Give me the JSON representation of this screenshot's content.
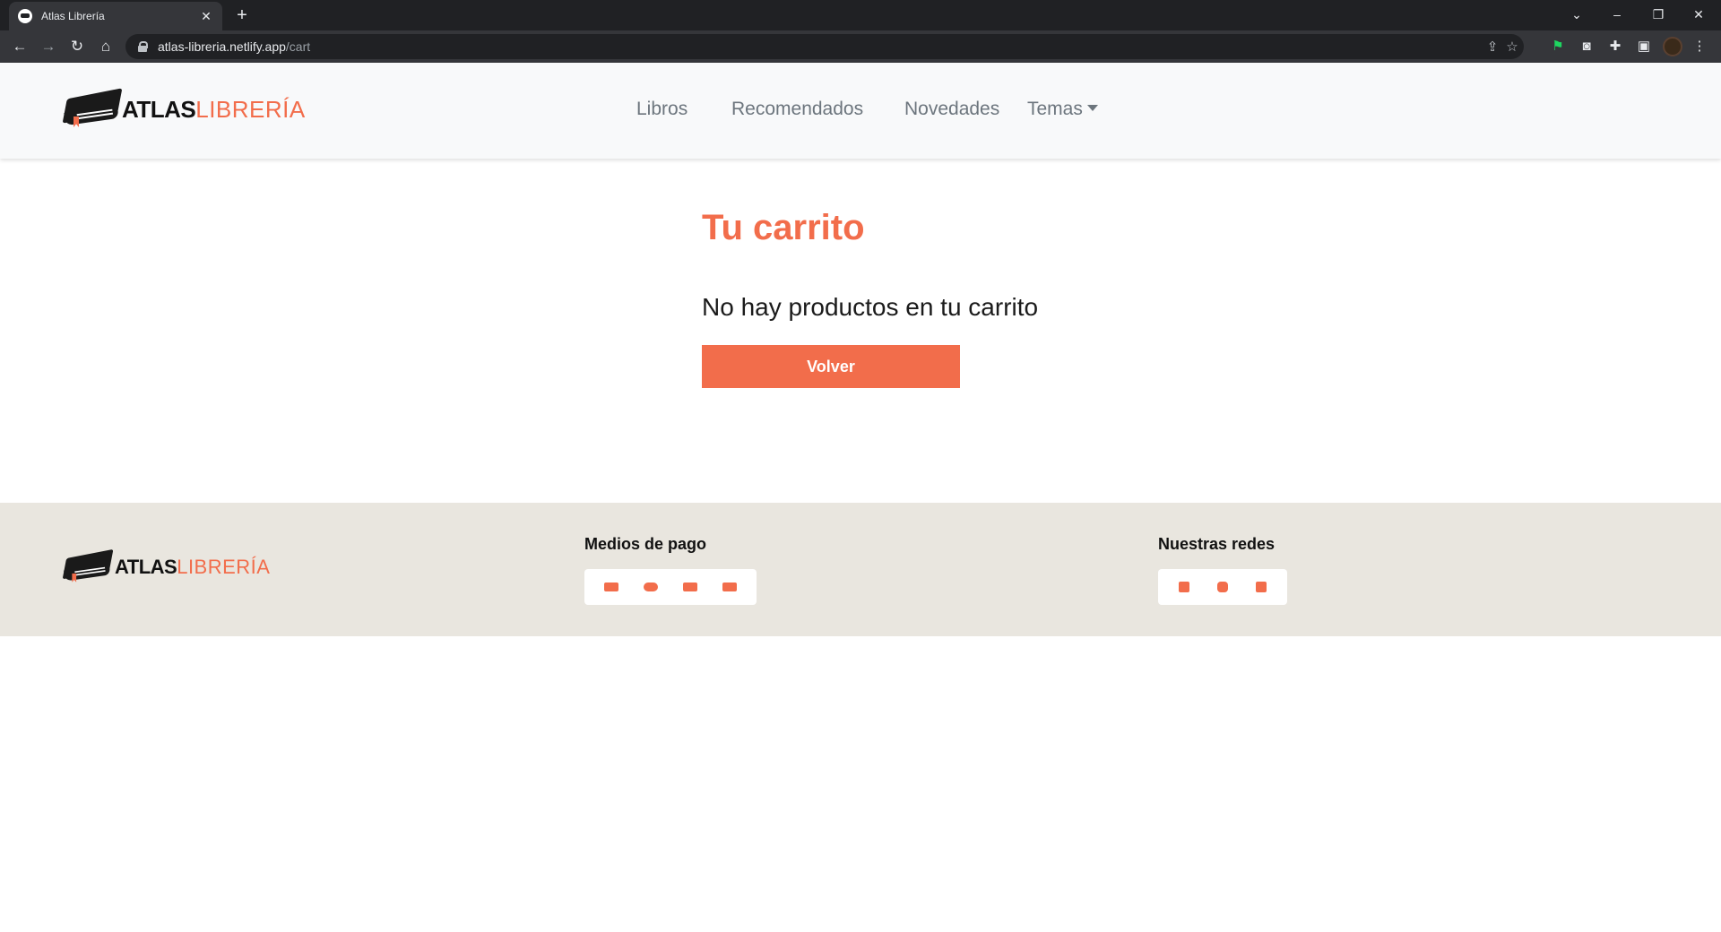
{
  "browser": {
    "tab_title": "Atlas Librería",
    "url_host": "atlas-libreria.netlify.app",
    "url_path": "/cart"
  },
  "site": {
    "logo_primary": "ATLAS",
    "logo_secondary": "LIBRERÍA",
    "nav": {
      "items": [
        "Libros",
        "Recomendados",
        "Novedades",
        "Temas"
      ]
    }
  },
  "main": {
    "title": "Tu carrito",
    "empty_message": "No hay productos en tu carrito",
    "back_button": "Volver"
  },
  "footer": {
    "payments_heading": "Medios de pago",
    "payment_icons": [
      "visa-icon",
      "mastercard-icon",
      "amex-icon",
      "paypal-icon"
    ],
    "social_heading": "Nuestras redes",
    "social_icons": [
      "facebook-icon",
      "instagram-icon",
      "twitter-icon"
    ]
  },
  "colors": {
    "accent": "#f26d4b",
    "navbar_bg": "#f8f9fa",
    "footer_bg": "#e9e6df",
    "nav_text": "#6c757d"
  }
}
